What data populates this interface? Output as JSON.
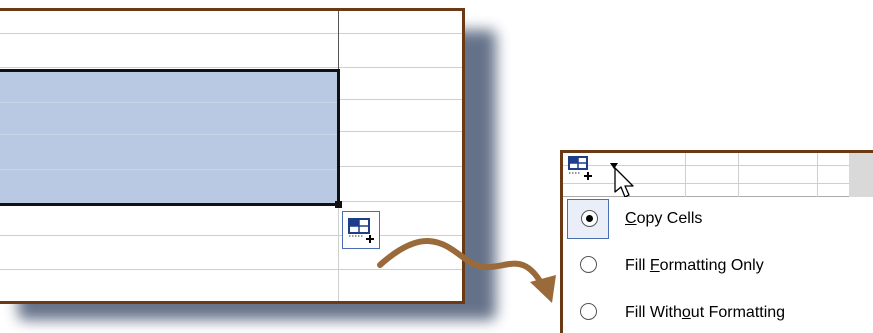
{
  "popup": {
    "menu_items": [
      {
        "pre": "",
        "accel": "C",
        "post": "opy Cells",
        "selected": true
      },
      {
        "pre": "Fill ",
        "accel": "F",
        "post": "ormatting Only",
        "selected": false
      },
      {
        "pre": "Fill With",
        "accel": "o",
        "post": "ut Formatting",
        "selected": false
      }
    ]
  },
  "colors": {
    "frame": "#6b3a14",
    "selection": "#b9c9e3",
    "accent_border": "#4a6fb0",
    "arrow": "#9a6a3a"
  },
  "icons": [
    "paste-options-smart-tag-icon",
    "dropdown-arrow-icon",
    "mouse-pointer-icon",
    "curved-arrow-icon"
  ]
}
